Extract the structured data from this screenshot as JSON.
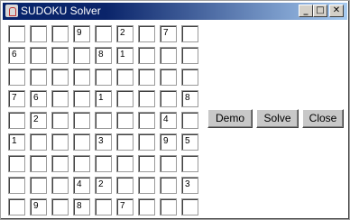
{
  "window": {
    "title": "SUDOKU Solver",
    "icon": "java-cup-icon",
    "controls": {
      "minimize": "_",
      "maximize": "□",
      "close": "✕"
    }
  },
  "grid": {
    "rows": [
      [
        "",
        "",
        "",
        "9",
        "",
        "2",
        "",
        "7",
        ""
      ],
      [
        "6",
        "",
        "",
        "",
        "8",
        "1",
        "",
        "",
        ""
      ],
      [
        "",
        "",
        "",
        "",
        "",
        "",
        "",
        "",
        ""
      ],
      [
        "7",
        "6",
        "",
        "",
        "1",
        "",
        "",
        "",
        "8"
      ],
      [
        "",
        "2",
        "",
        "",
        "",
        "",
        "",
        "4",
        ""
      ],
      [
        "1",
        "",
        "",
        "",
        "3",
        "",
        "",
        "9",
        "5"
      ],
      [
        "",
        "",
        "",
        "",
        "",
        "",
        "",
        "",
        ""
      ],
      [
        "",
        "",
        "",
        "4",
        "2",
        "",
        "",
        "",
        "3"
      ],
      [
        "",
        "9",
        "",
        "8",
        "",
        "7",
        "",
        "",
        ""
      ]
    ]
  },
  "buttons": {
    "demo": "Demo",
    "solve": "Solve",
    "close": "Close"
  }
}
